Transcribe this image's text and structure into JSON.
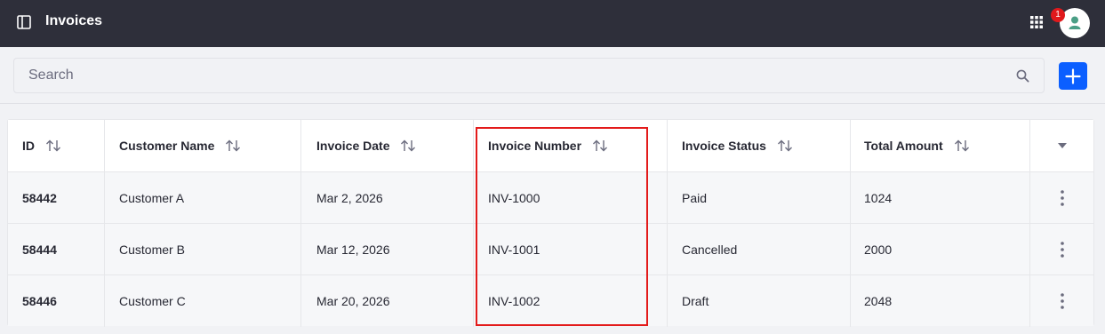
{
  "header": {
    "title": "Invoices",
    "notification_count": "1",
    "icons": {
      "panel_toggle": "sidebar-toggle-icon",
      "apps": "apps-grid-icon",
      "user": "user-avatar-icon"
    }
  },
  "search": {
    "placeholder": "Search",
    "value": "",
    "icon": "search-icon"
  },
  "add_button": {
    "icon": "plus-icon"
  },
  "table": {
    "columns": [
      "ID",
      "Customer Name",
      "Invoice Date",
      "Invoice Number",
      "Invoice Status",
      "Total Amount"
    ],
    "rows": [
      {
        "id": "58442",
        "customer": "Customer A",
        "date": "Mar 2, 2026",
        "number": "INV-1000",
        "status": "Paid",
        "amount": "1024"
      },
      {
        "id": "58444",
        "customer": "Customer B",
        "date": "Mar 12, 2026",
        "number": "INV-1001",
        "status": "Cancelled",
        "amount": "2000"
      },
      {
        "id": "58446",
        "customer": "Customer C",
        "date": "Mar 20, 2026",
        "number": "INV-1002",
        "status": "Draft",
        "amount": "2048"
      }
    ]
  },
  "colors": {
    "topbar": "#2e2f3a",
    "accent": "#0b5fff",
    "badge": "#e0191c",
    "highlight": "#e31b1b",
    "avatar_icon": "#4b9f86"
  }
}
